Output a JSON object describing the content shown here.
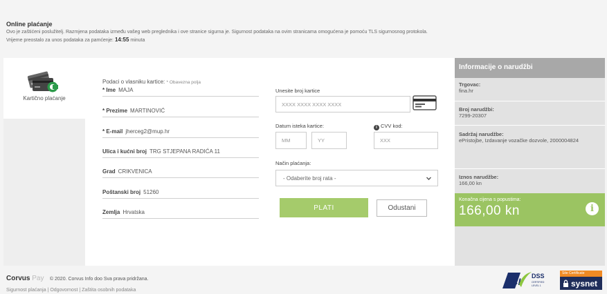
{
  "notice": {
    "title": "Online plaćanje",
    "line1": "Ovo je zaštićeni poslužitelj. Razmjena podataka između vašeg web preglednika i ove stranice sigurna je. Sigurnost podataka na ovim stranicama omogućena je pomoću TLS sigurnosnog protokola.",
    "line2_prefix": "Vrijeme preostalo za unos podataka za pamćenje:",
    "time_value": "14:55",
    "time_unit": "minuta"
  },
  "payment_method": {
    "label": "Kartično plaćanje",
    "icon": "credit-cards-icon"
  },
  "owner": {
    "heading": "Podaci o vlasniku kartice:",
    "required_note": "* Obavezna polja",
    "fields": [
      {
        "label": "* Ime",
        "value": "MAJA"
      },
      {
        "label": "* Prezime",
        "value": "MARTINOVIĆ"
      },
      {
        "label": "* E-mail",
        "value": "jherceg2@mup.hr"
      },
      {
        "label": "Ulica i kućni broj",
        "value": "TRG STJEPANA RADIĆA 11"
      },
      {
        "label": "Grad",
        "value": "CRIKVENICA"
      },
      {
        "label": "Poštanski broj",
        "value": "51260"
      },
      {
        "label": "Zemlja",
        "value": "Hrvatska"
      }
    ]
  },
  "card": {
    "number_label": "Unesite broj kartice",
    "number_placeholder": "XXXX XXXX XXXX XXXX",
    "expiry_label": "Datum isteka kartice:",
    "month_placeholder": "MM",
    "year_placeholder": "YY",
    "cvv_label": "CVV kod:",
    "cvv_placeholder": "XXX",
    "method_label": "Način plaćanja:",
    "method_selected": "- Odaberite broj rata -",
    "pay_button": "PLATI",
    "cancel_button": "Odustani"
  },
  "order": {
    "heading": "Informacije o narudžbi",
    "merchant_label": "Trgovac:",
    "merchant_value": "fina.hr",
    "order_no_label": "Broj narudžbi:",
    "order_no_value": "7299-20307",
    "content_label": "Sadržaj narudžbe:",
    "content_value": "ePristojbe, Izdavanje vozačke dozvole, 2000004824",
    "amount_label": "Iznos narudžbe:",
    "amount_value": "166,00 kn",
    "discount_label": "Konačna cijena s popustima:",
    "discount_value": "166,00 kn"
  },
  "footer": {
    "brand_corvus": "Corvus",
    "brand_pay": "Pay",
    "copyright": "© 2020. Corvus Info doo Sva prava pridržana.",
    "link_security": "Sigurnost plaćanja",
    "link_responsibility": "Odgovornost",
    "link_privacy": "Zaštita osobnih podataka"
  },
  "badges": {
    "pci_text": "PCI",
    "dss_text": "DSS",
    "certified_text": "CERTIFIED",
    "level_text": "LEVEL 1",
    "sysnet_top": "Site Certificate",
    "sysnet_name": "sysnet"
  },
  "colors": {
    "accent_green": "#9bc462",
    "button_green": "#a5cb6b",
    "order_header": "#a8a8a8"
  }
}
